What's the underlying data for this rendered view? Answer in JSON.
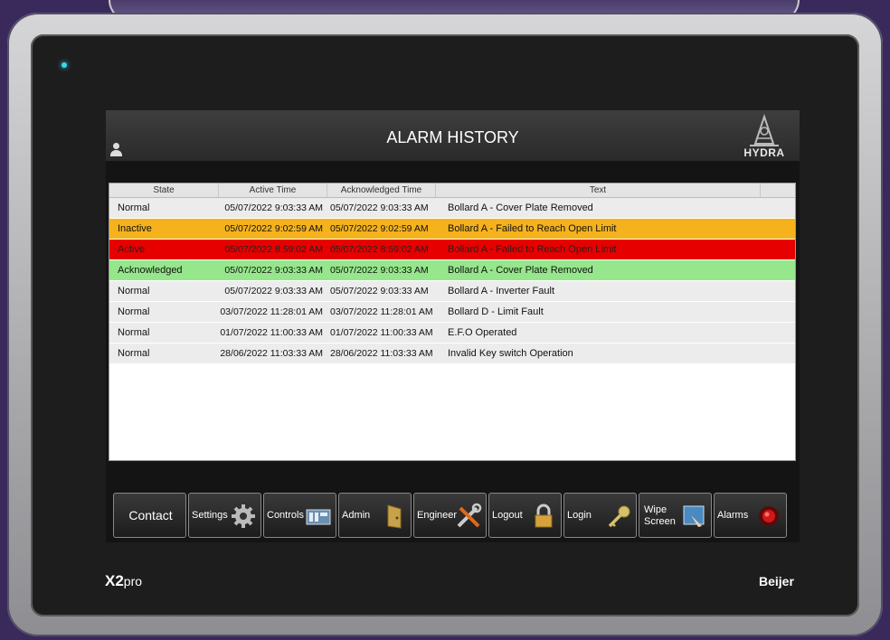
{
  "device": {
    "brand_model": "X2",
    "brand_model_suffix": "pro",
    "manufacturer": "Beijer"
  },
  "header": {
    "title": "ALARM HISTORY",
    "logo_text": "HYDRA"
  },
  "table": {
    "columns": [
      "State",
      "Active Time",
      "Acknowledged Time",
      "Text"
    ],
    "rows": [
      {
        "state": "Normal",
        "active": "05/07/2022 9:03:33 AM",
        "ack": "05/07/2022 9:03:33 AM",
        "text": "Bollard A - Cover Plate Removed",
        "status": "normal"
      },
      {
        "state": "Inactive",
        "active": "05/07/2022 9:02:59 AM",
        "ack": "05/07/2022 9:02:59 AM",
        "text": "Bollard A - Failed to Reach Open Limit",
        "status": "inactive"
      },
      {
        "state": "Active",
        "active": "05/07/2022 8:59:02 AM",
        "ack": "05/07/2022 8:59:02 AM",
        "text": "Bollard A - Failed to Reach Open Limit",
        "status": "active"
      },
      {
        "state": "Acknowledged",
        "active": "05/07/2022 9:03:33 AM",
        "ack": "05/07/2022 9:03:33 AM",
        "text": "Bollard A - Cover Plate Removed",
        "status": "acknowledged"
      },
      {
        "state": "Normal",
        "active": "05/07/2022 9:03:33 AM",
        "ack": "05/07/2022 9:03:33 AM",
        "text": "Bollard A - Inverter Fault",
        "status": "normal"
      },
      {
        "state": "Normal",
        "active": "03/07/2022 11:28:01 AM",
        "ack": "03/07/2022 11:28:01 AM",
        "text": "Bollard D - Limit Fault",
        "status": "normal"
      },
      {
        "state": "Normal",
        "active": "01/07/2022 11:00:33 AM",
        "ack": "01/07/2022 11:00:33 AM",
        "text": "E.F.O Operated",
        "status": "normal"
      },
      {
        "state": "Normal",
        "active": "28/06/2022 11:03:33 AM",
        "ack": "28/06/2022 11:03:33 AM",
        "text": "Invalid Key switch Operation",
        "status": "normal"
      }
    ],
    "status_colors": {
      "normal": "#ececec",
      "inactive": "#f5b21c",
      "active": "#e60000",
      "acknowledged": "#96e68c"
    }
  },
  "buttons": [
    {
      "label": "Contact",
      "icon": "none"
    },
    {
      "label": "Settings",
      "icon": "gear-icon"
    },
    {
      "label": "Controls",
      "icon": "control-panel-icon"
    },
    {
      "label": "Admin",
      "icon": "door-icon"
    },
    {
      "label": "Engineer",
      "icon": "tools-icon"
    },
    {
      "label": "Logout",
      "icon": "padlock-icon"
    },
    {
      "label": "Login",
      "icon": "key-icon"
    },
    {
      "label": "Wipe Screen",
      "label_line1": "Wipe",
      "label_line2": "Screen",
      "icon": "wipe-screen-icon"
    },
    {
      "label": "Alarms",
      "icon": "alarm-bell-icon"
    }
  ]
}
